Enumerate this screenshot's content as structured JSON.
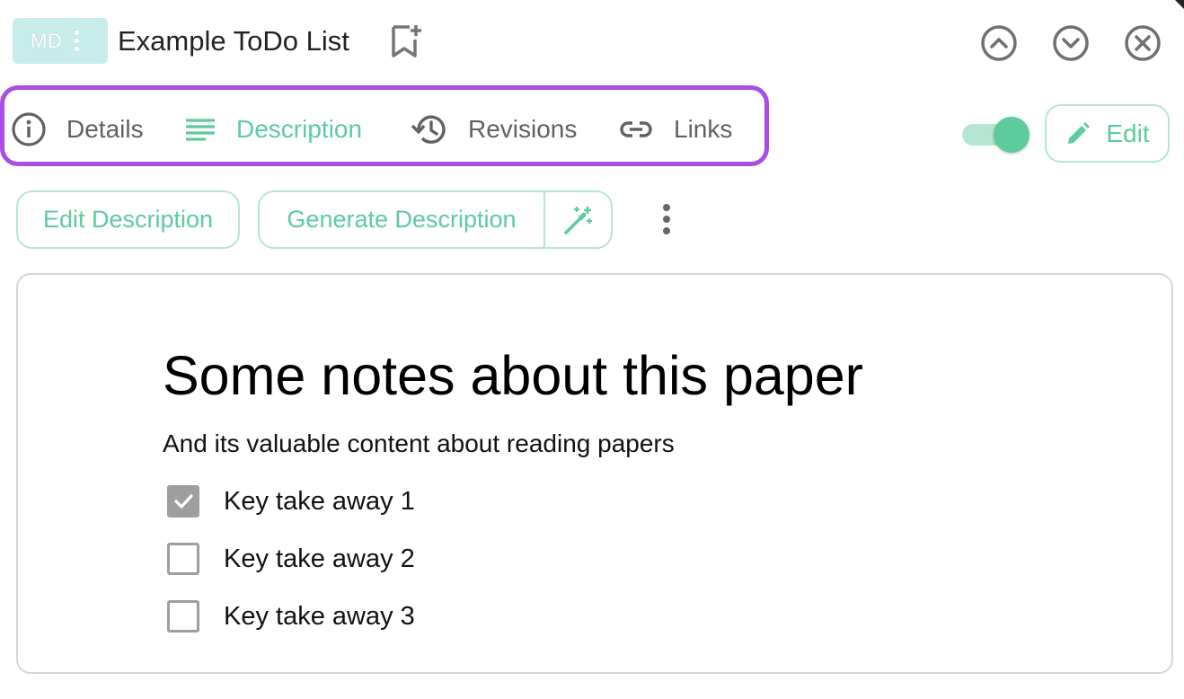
{
  "header": {
    "badge": "MD",
    "title": "Example ToDo List",
    "icons": [
      "bookmark-add-icon",
      "chevron-up-circle-icon",
      "chevron-down-circle-icon",
      "close-circle-icon"
    ]
  },
  "tabs": [
    {
      "label": "Details",
      "icon": "info-icon",
      "active": false
    },
    {
      "label": "Description",
      "icon": "lines-icon",
      "active": true
    },
    {
      "label": "Revisions",
      "icon": "history-icon",
      "active": false
    },
    {
      "label": "Links",
      "icon": "link-icon",
      "active": false
    }
  ],
  "toggle": {
    "on": true
  },
  "actions": {
    "edit_label": "Edit",
    "edit_description": "Edit Description",
    "generate_description": "Generate Description"
  },
  "colors": {
    "accent": "#5ccb9e",
    "accent_light": "#b5e6d3",
    "highlight_frame": "#a94ee4",
    "badge_bg": "#c8ece9"
  },
  "content": {
    "heading": "Some notes about this paper",
    "subtitle": "And its valuable content about reading papers",
    "todos": [
      {
        "label": "Key take away 1",
        "checked": true
      },
      {
        "label": "Key take away 2",
        "checked": false
      },
      {
        "label": "Key take away 3",
        "checked": false
      }
    ]
  }
}
